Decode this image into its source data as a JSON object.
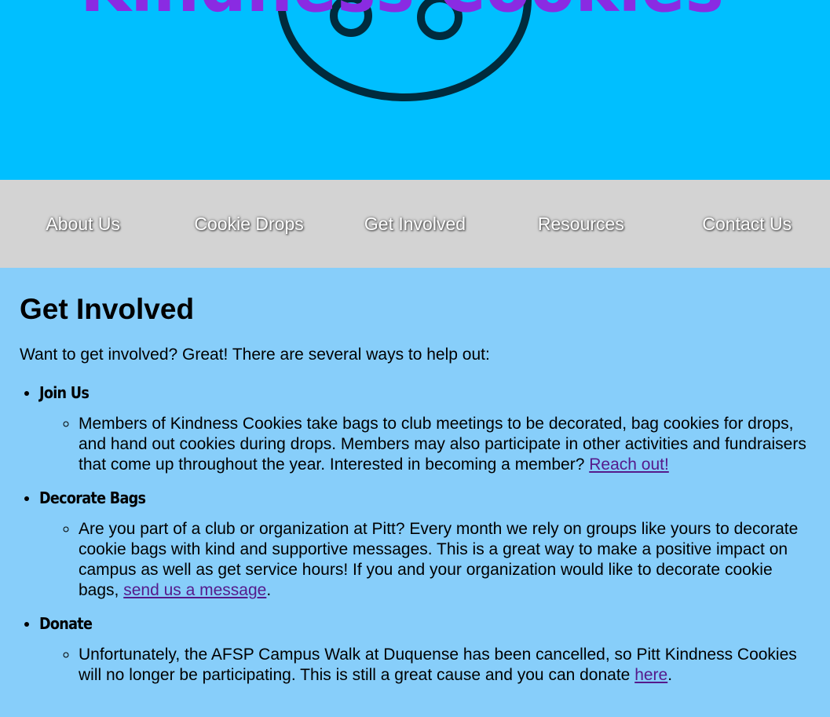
{
  "banner": {
    "logo_text": "Kindness Cookies",
    "colors": {
      "background": "#00bfff",
      "logo_text": "#8a2be2",
      "cookie_outline": "#002b3d"
    }
  },
  "nav": {
    "items": [
      "About Us",
      "Cookie Drops",
      "Get Involved",
      "Resources",
      "Contact Us"
    ]
  },
  "main": {
    "title": "Get Involved",
    "intro": "Want to get involved? Great! There are several ways to help out:",
    "sections": [
      {
        "heading": "Join Us",
        "text": "Members of Kindness Cookies take bags to club meetings to be decorated, bag cookies for drops, and hand out cookies during drops. Members may also participate in other activities and fundraisers that come up throughout the year. Interested in becoming a member? ",
        "link": "Reach out!",
        "after": ""
      },
      {
        "heading": "Decorate Bags",
        "text": "Are you part of a club or organization at Pitt? Every month we rely on groups like yours to decorate cookie bags with kind and supportive messages. This is a great way to make a positive impact on campus as well as get service hours! If you and your organization would like to decorate cookie bags, ",
        "link": "send us a message",
        "after": "."
      },
      {
        "heading": "Donate",
        "text": "Unfortunately, the AFSP Campus Walk at Duquense has been cancelled, so Pitt Kindness Cookies will no longer be participating. This is still a great cause and you can donate ",
        "link": "here",
        "after": "."
      }
    ]
  },
  "colors": {
    "page_background": "#87cefa",
    "nav_background": "#d3d3d3",
    "link": "#551a8b"
  }
}
